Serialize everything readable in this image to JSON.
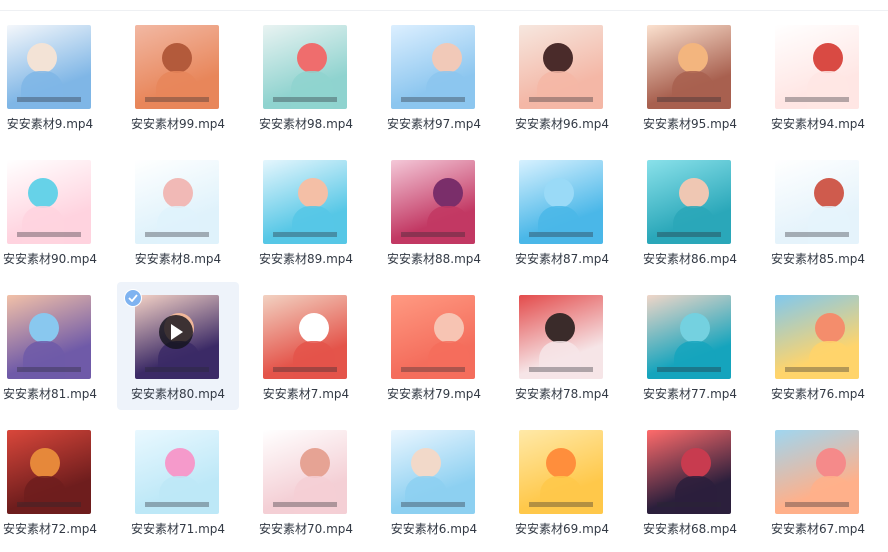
{
  "files": [
    {
      "name": "安安素材9.mp4",
      "colors": [
        "#7fb6e6",
        "#f3e3d6",
        "#f4f7fb"
      ]
    },
    {
      "name": "安安素材99.mp4",
      "colors": [
        "#e8865a",
        "#b35a3b",
        "#f2b8a3"
      ]
    },
    {
      "name": "安安素材98.mp4",
      "colors": [
        "#8fd3cf",
        "#ef6d6d",
        "#e9f3f2"
      ]
    },
    {
      "name": "安安素材97.mp4",
      "colors": [
        "#8cc6ef",
        "#f1c9b8",
        "#dcefff"
      ]
    },
    {
      "name": "安安素材96.mp4",
      "colors": [
        "#f4b7a6",
        "#4a2b2a",
        "#f6e7df"
      ]
    },
    {
      "name": "安安素材95.mp4",
      "colors": [
        "#a8604f",
        "#f3b57e",
        "#fbe1cf"
      ]
    },
    {
      "name": "安安素材94.mp4",
      "colors": [
        "#ffe6e4",
        "#d94a43",
        "#ffffff"
      ]
    },
    {
      "name": "安安素材90.mp4",
      "colors": [
        "#ffd3df",
        "#66d2e8",
        "#ffffff"
      ]
    },
    {
      "name": "安安素材8.mp4",
      "colors": [
        "#dff2fb",
        "#f1b9b6",
        "#ffffff"
      ]
    },
    {
      "name": "安安素材89.mp4",
      "colors": [
        "#56c7e6",
        "#f4bfa6",
        "#e5f6fd"
      ]
    },
    {
      "name": "安安素材88.mp4",
      "colors": [
        "#c23863",
        "#7a2e6a",
        "#f4c8d8"
      ]
    },
    {
      "name": "安安素材87.mp4",
      "colors": [
        "#4ab7e8",
        "#9adaf7",
        "#d7f1ff"
      ]
    },
    {
      "name": "安安素材86.mp4",
      "colors": [
        "#2aa7b9",
        "#efc7b3",
        "#8ae1ea"
      ]
    },
    {
      "name": "安安素材85.mp4",
      "colors": [
        "#e5f3fb",
        "#cf5b4d",
        "#ffffff"
      ]
    },
    {
      "name": "安安素材81.mp4",
      "colors": [
        "#6f5aa8",
        "#89c8ef",
        "#f2c1a8"
      ]
    },
    {
      "name": "安安素材80.mp4",
      "colors": [
        "#3b2a66",
        "#f0b79a",
        "#f4d2c6"
      ]
    },
    {
      "name": "安安素材7.mp4",
      "colors": [
        "#e4544a",
        "#ffffff",
        "#f2d2c2"
      ]
    },
    {
      "name": "安安素材79.mp4",
      "colors": [
        "#f46d5c",
        "#f7c4b3",
        "#ff9a82"
      ]
    },
    {
      "name": "安安素材78.mp4",
      "colors": [
        "#f6e5e7",
        "#3a2b2a",
        "#e34b4b"
      ]
    },
    {
      "name": "安安素材77.mp4",
      "colors": [
        "#15a4bd",
        "#74d1e0",
        "#f0d6c8"
      ]
    },
    {
      "name": "安安素材76.mp4",
      "colors": [
        "#ffd46b",
        "#f48d6c",
        "#80c8ee"
      ]
    },
    {
      "name": "安安素材72.mp4",
      "colors": [
        "#6e1d1d",
        "#e6883a",
        "#d9473b"
      ]
    },
    {
      "name": "安安素材71.mp4",
      "colors": [
        "#bde8f7",
        "#f59acb",
        "#e9f8ff"
      ]
    },
    {
      "name": "安安素材70.mp4",
      "colors": [
        "#f4cfd5",
        "#e6a394",
        "#ffffff"
      ]
    },
    {
      "name": "安安素材6.mp4",
      "colors": [
        "#8dd0f1",
        "#f2d9c9",
        "#eaf6ff"
      ]
    },
    {
      "name": "安安素材69.mp4",
      "colors": [
        "#ffc84a",
        "#ff8e3c",
        "#ffe9a8"
      ]
    },
    {
      "name": "安安素材68.mp4",
      "colors": [
        "#2b1f3c",
        "#c83b4f",
        "#ff6b6b"
      ]
    },
    {
      "name": "安安素材67.mp4",
      "colors": [
        "#ffb08a",
        "#f58a8a",
        "#9fd6f0"
      ]
    }
  ],
  "selected_index": 15,
  "icons": {
    "check": "check-icon",
    "play": "play-icon"
  },
  "theme": {
    "selected_bg": "#eef3fa",
    "badge": "#7fb3f0"
  }
}
